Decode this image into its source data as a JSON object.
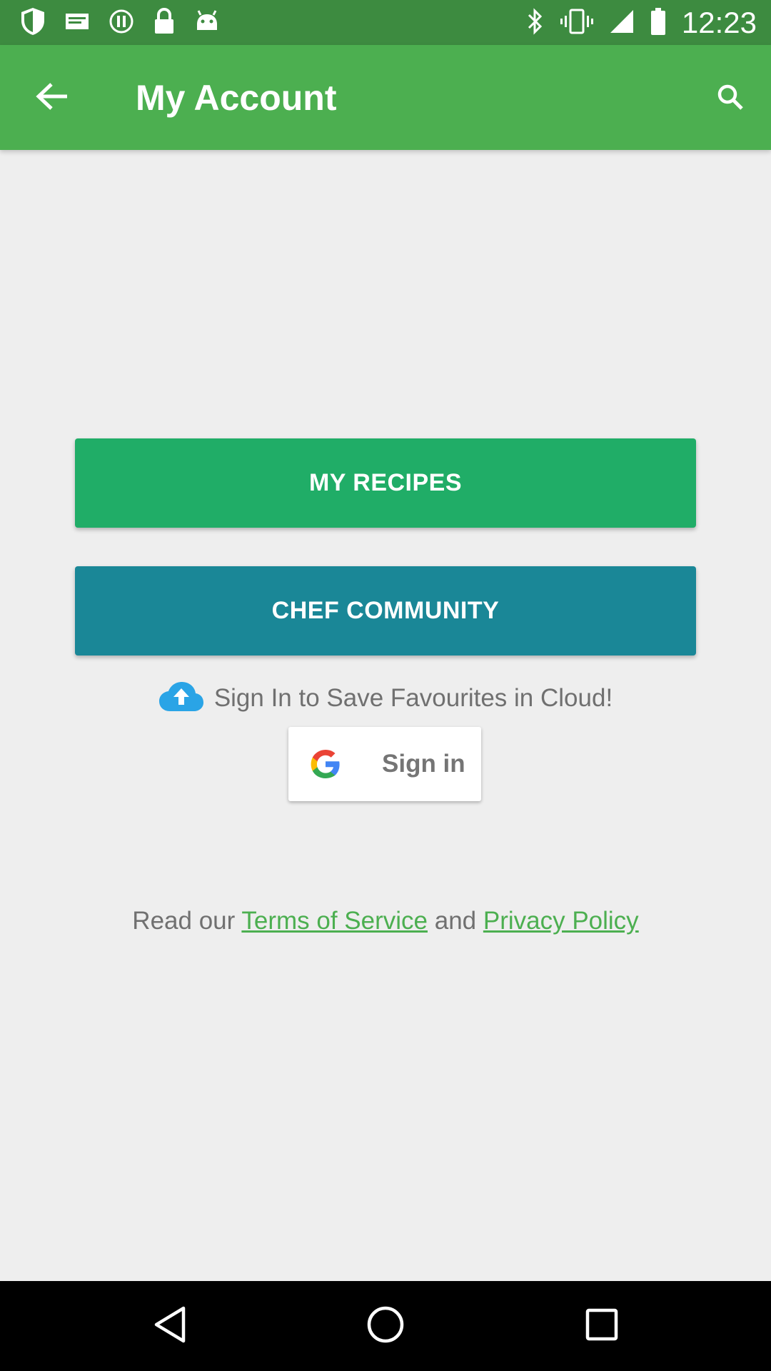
{
  "status_bar": {
    "time": "12:23",
    "left_icons": [
      "shield-icon",
      "mail-icon",
      "info-circle-icon",
      "lock-icon",
      "android-icon"
    ],
    "right_icons": [
      "bluetooth-icon",
      "vibrate-icon",
      "signal-icon",
      "battery-icon"
    ]
  },
  "app_bar": {
    "title": "My Account",
    "back_icon": "arrow-back-icon",
    "search_icon": "search-icon",
    "color": "#4caf50"
  },
  "main": {
    "my_recipes_label": "MY RECIPES",
    "chef_community_label": "CHEF COMMUNITY",
    "cloud_prompt": "Sign In to Save Favourites in Cloud!",
    "google_signin_label": "Sign in",
    "legal": {
      "prefix": "Read our ",
      "terms_label": "Terms of Service",
      "middle": " and ",
      "privacy_label": "Privacy Policy"
    }
  },
  "colors": {
    "status_bar": "#3d8b40",
    "app_bar": "#4caf50",
    "my_recipes_button": "#20ad67",
    "chef_community_button": "#1a8797",
    "link": "#4caf50",
    "background": "#eeeeee"
  },
  "nav_bar": {
    "icons": [
      "back-triangle-icon",
      "home-circle-icon",
      "recents-square-icon"
    ]
  }
}
